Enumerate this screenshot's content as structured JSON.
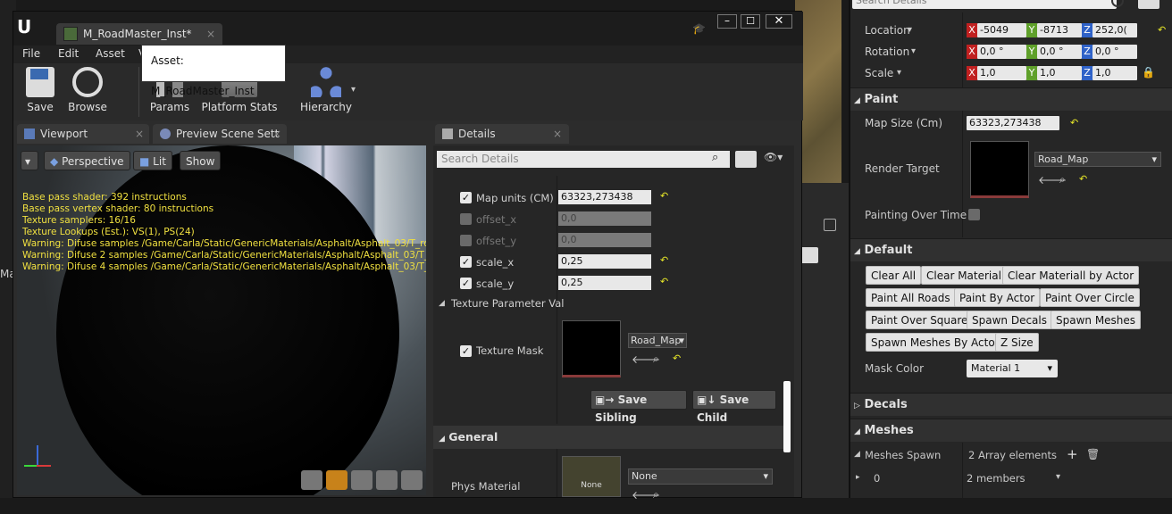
{
  "window": {
    "tab_title": "M_RoadMaster_Inst*",
    "tooltip": "Asset: M_RoadMaster_Inst"
  },
  "menu": [
    "File",
    "Edit",
    "Asset",
    "V"
  ],
  "toolbar": [
    {
      "label": "Save",
      "icon": "save-icon"
    },
    {
      "label": "Browse",
      "icon": "browse-icon"
    },
    {
      "label": "Params",
      "icon": "params-icon"
    },
    {
      "label": "Platform Stats",
      "icon": "platform-stats-icon"
    },
    {
      "label": "Hierarchy",
      "icon": "hierarchy-icon"
    }
  ],
  "panels": {
    "viewport": "Viewport",
    "preview": "Preview Scene Sett",
    "details": "Details"
  },
  "viewport": {
    "buttons": [
      "Perspective",
      "Lit",
      "Show"
    ],
    "stats": [
      "Base pass shader: 392 instructions",
      "Base pass vertex shader: 80 instructions",
      "Texture samplers: 16/16",
      "Texture Lookups (Est.): VS(1), PS(24)",
      "Warning: Difuse samples /Game/Carla/Static/GenericMaterials/Asphalt/Asphalt_03/T_roadB",
      "Warning: Difuse 2 samples /Game/Carla/Static/GenericMaterials/Asphalt/Asphalt_03/T_roa",
      "Warning: Difuse 4 samples /Game/Carla/Static/GenericMaterials/Asphalt/Asphalt_03/T_roa"
    ]
  },
  "details": {
    "search_placeholder": "Search Details",
    "params": [
      {
        "label": "Map units (CM)",
        "value": "63323,273438",
        "checked": true
      },
      {
        "label": "offset_x",
        "value": "0,0",
        "checked": false
      },
      {
        "label": "offset_y",
        "value": "0,0",
        "checked": false
      },
      {
        "label": "scale_x",
        "value": "0,25",
        "checked": true
      },
      {
        "label": "scale_y",
        "value": "0,25",
        "checked": true
      }
    ],
    "texture_section": "Texture Parameter Val",
    "texture_mask": "Texture Mask",
    "texture_value": "Road_Map",
    "save_sibling": "Save Sibling",
    "save_child": "Save Child",
    "general": "General",
    "phys_material": "Phys Material",
    "phys_thumb": "None",
    "phys_value": "None"
  },
  "right": {
    "search_placeholder": "Search Details",
    "location": {
      "label": "Location",
      "x": "-5049",
      "y": "-8713",
      "z": "252,0("
    },
    "rotation": {
      "label": "Rotation",
      "x": "0,0 °",
      "y": "0,0 °",
      "z": "0,0 °"
    },
    "scale": {
      "label": "Scale",
      "x": "1,0",
      "y": "1,0",
      "z": "1,0"
    },
    "paint": "Paint",
    "map_size_label": "Map Size (Cm)",
    "map_size": "63323,273438",
    "render_target_label": "Render Target",
    "render_target": "Road_Map",
    "painting_over_time": "Painting Over Time",
    "default": "Default",
    "buttons": [
      "Clear All",
      "Clear Material",
      "Clear Materiall by Actor",
      "Paint All Roads",
      "Paint By Actor",
      "Paint Over Circle",
      "Paint Over Square",
      "Spawn Decals",
      "Spawn Meshes",
      "Spawn Meshes By Actor",
      "Z Size"
    ],
    "mask_color_label": "Mask Color",
    "mask_color": "Material 1",
    "decals": "Decals",
    "meshes": "Meshes",
    "meshes_spawn": "Meshes Spawn",
    "meshes_spawn_value": "2 Array elements",
    "index0": "0",
    "index0_value": "2 members"
  }
}
